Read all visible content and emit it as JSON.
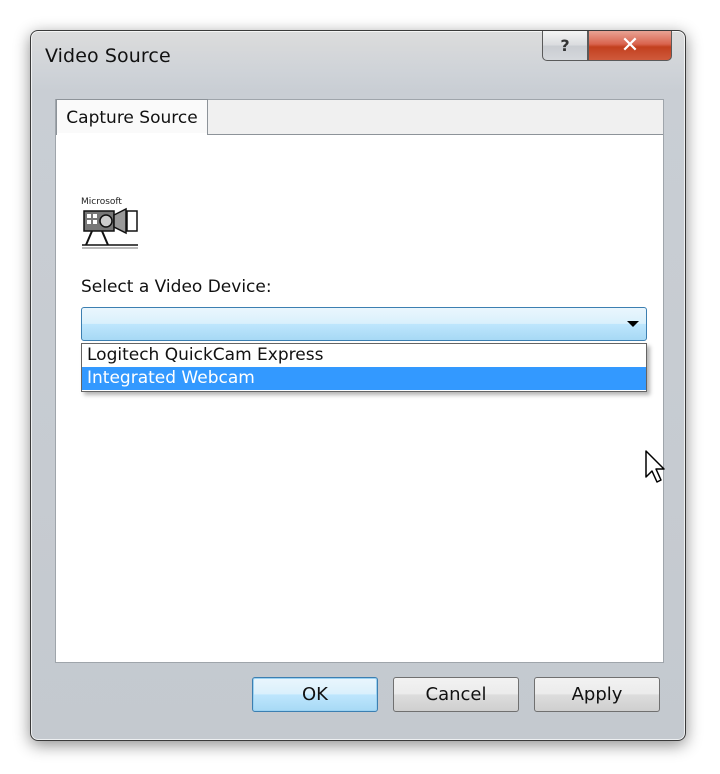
{
  "window": {
    "title": "Video Source",
    "help_glyph": "?",
    "close_glyph": "✕"
  },
  "tabs": [
    {
      "label": "Capture Source",
      "active": true
    }
  ],
  "capture": {
    "icon": "video-camera-icon",
    "icon_caption": "Microsoft",
    "device_label": "Select a Video Device:",
    "device_value": "",
    "options": [
      {
        "label": "Logitech QuickCam Express",
        "selected": false
      },
      {
        "label": "Integrated Webcam",
        "selected": true
      }
    ]
  },
  "buttons": {
    "ok": "OK",
    "cancel": "Cancel",
    "apply": "Apply"
  },
  "colors": {
    "selection": "#3399ff",
    "close_button": "#c8462a",
    "focus_border": "#3c7fb1"
  }
}
